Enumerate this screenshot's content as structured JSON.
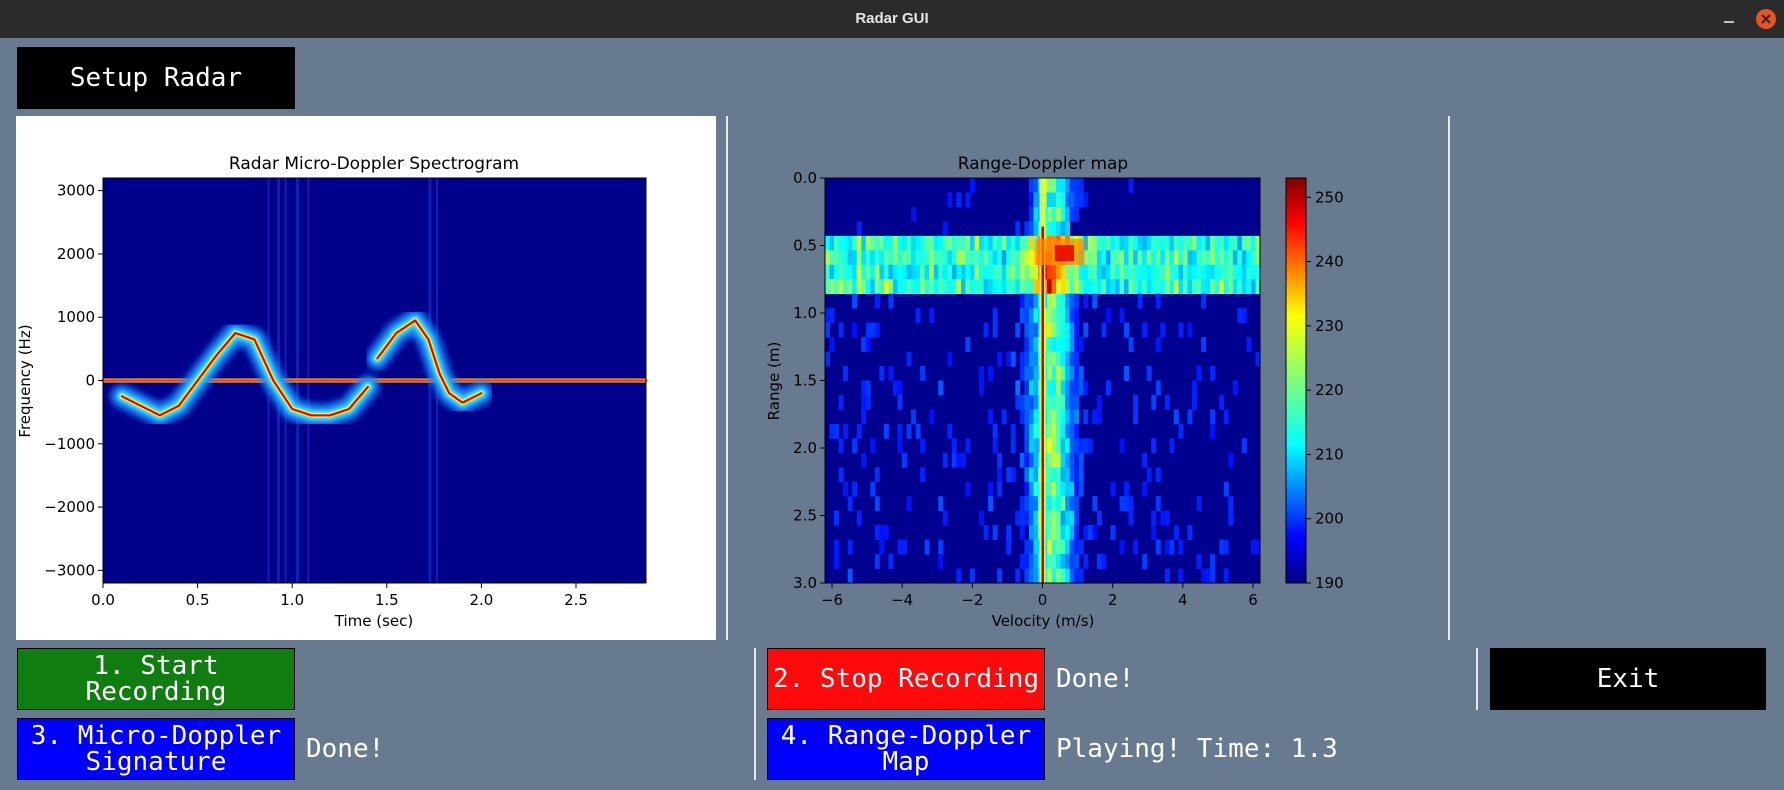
{
  "window": {
    "title": "Radar GUI"
  },
  "buttons": {
    "setup": "Setup Radar",
    "start": "1. Start Recording",
    "stop": "2. Stop Recording",
    "micro": "3. Micro-Doppler\nSignature",
    "range": "4. Range-Doppler\nMap",
    "exit": "Exit"
  },
  "status": {
    "stop": "Done!",
    "micro": "Done!",
    "range": "Playing! Time: 1.3"
  },
  "colors": {
    "window_bg": "#687a90",
    "start": "#0f7d0f",
    "stop": "#ff0a0a",
    "action": "#0000ff",
    "plain": "#000000"
  },
  "spectrogram": {
    "title": "Radar Micro-Doppler Spectrogram",
    "xlabel": "Time (sec)",
    "ylabel": "Frequency (Hz)",
    "xticks": [
      "0.0",
      "0.5",
      "1.0",
      "1.5",
      "2.0",
      "2.5"
    ],
    "yticks": [
      "3000",
      "2000",
      "1000",
      "0",
      "−1000",
      "−2000",
      "−3000"
    ]
  },
  "rdmap": {
    "title": "Range-Doppler map",
    "xlabel": "Velocity (m/s)",
    "ylabel": "Range (m)",
    "xticks": [
      "−6",
      "−4",
      "−2",
      "0",
      "2",
      "4",
      "6"
    ],
    "yticks": [
      "0.0",
      "0.5",
      "1.0",
      "1.5",
      "2.0",
      "2.5",
      "3.0"
    ],
    "colorbar_ticks": [
      "250",
      "240",
      "230",
      "220",
      "210",
      "200",
      "190"
    ]
  },
  "chart_data": [
    {
      "type": "heatmap",
      "title": "Radar Micro-Doppler Spectrogram",
      "xlabel": "Time (sec)",
      "ylabel": "Frequency (Hz)",
      "xlim": [
        0,
        2.87
      ],
      "ylim": [
        -3200,
        3200
      ],
      "series": [
        {
          "name": "",
          "points": [
            [
              0.0,
              0
            ],
            [
              0.5,
              0
            ],
            [
              1.0,
              0
            ],
            [
              1.5,
              0
            ],
            [
              2.0,
              0
            ],
            [
              2.5,
              0
            ],
            [
              2.87,
              0
            ]
          ]
        },
        {
          "name": "",
          "points": [
            [
              0.1,
              -250
            ],
            [
              0.2,
              -400
            ],
            [
              0.3,
              -550
            ],
            [
              0.4,
              -400
            ],
            [
              0.5,
              0
            ],
            [
              0.6,
              400
            ],
            [
              0.7,
              750
            ],
            [
              0.8,
              650
            ],
            [
              0.9,
              0
            ],
            [
              1.0,
              -450
            ],
            [
              1.1,
              -550
            ],
            [
              1.2,
              -550
            ],
            [
              1.3,
              -450
            ],
            [
              1.4,
              -100
            ]
          ]
        },
        {
          "name": "",
          "points": [
            [
              1.45,
              350
            ],
            [
              1.55,
              750
            ],
            [
              1.65,
              950
            ],
            [
              1.72,
              650
            ],
            [
              1.78,
              100
            ],
            [
              1.83,
              -200
            ],
            [
              1.9,
              -350
            ],
            [
              2.0,
              -200
            ]
          ]
        }
      ]
    },
    {
      "type": "heatmap",
      "title": "Range-Doppler map",
      "xlabel": "Velocity (m/s)",
      "ylabel": "Range (m)",
      "xlim": [
        -6.2,
        6.2
      ],
      "ylim": [
        3.0,
        0.0
      ],
      "colorbar": {
        "min": 190,
        "max": 253
      },
      "series": [
        {
          "name": "",
          "points": [
            [
              0.0,
              0.5
            ],
            [
              0.0,
              1.0
            ],
            [
              0.0,
              2.0
            ],
            [
              0.0,
              3.0
            ]
          ]
        },
        {
          "name": "",
          "points": [
            [
              -6,
              0.6
            ],
            [
              -3,
              0.6
            ],
            [
              0,
              0.6
            ],
            [
              3,
              0.6
            ],
            [
              6,
              0.6
            ]
          ]
        }
      ]
    }
  ]
}
